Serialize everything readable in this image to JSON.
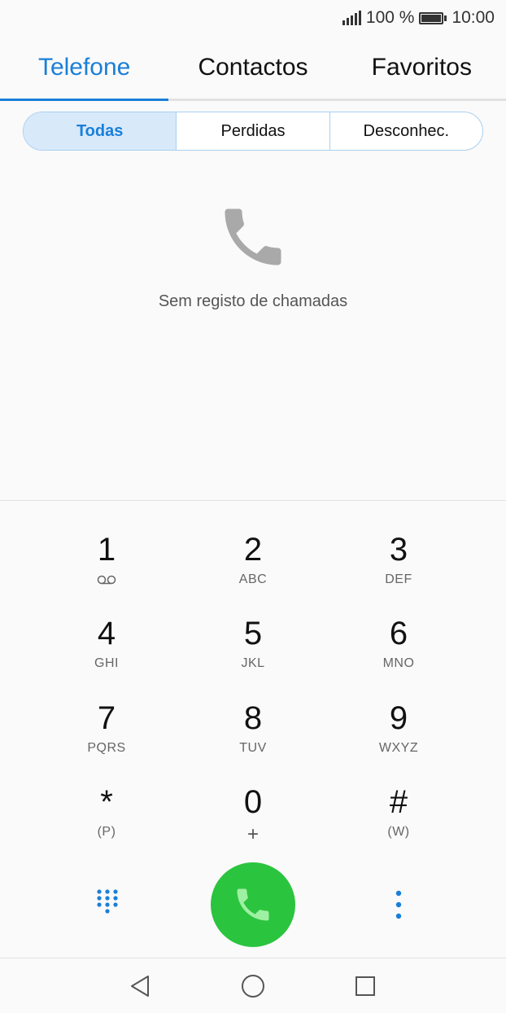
{
  "status_bar": {
    "battery_text": "100 %",
    "time": "10:00",
    "signal_icon": "signal-bars-icon",
    "battery_icon": "battery-full-icon"
  },
  "tabs": [
    {
      "label": "Telefone",
      "active": true
    },
    {
      "label": "Contactos",
      "active": false
    },
    {
      "label": "Favoritos",
      "active": false
    }
  ],
  "filters": [
    {
      "label": "Todas",
      "active": true
    },
    {
      "label": "Perdidas",
      "active": false
    },
    {
      "label": "Desconhec.",
      "active": false
    }
  ],
  "empty_state": {
    "icon": "phone-handset-icon",
    "message": "Sem registo de chamadas"
  },
  "keypad": {
    "keys": [
      {
        "digit": "1",
        "letters": ""
      },
      {
        "digit": "2",
        "letters": "ABC"
      },
      {
        "digit": "3",
        "letters": "DEF"
      },
      {
        "digit": "4",
        "letters": "GHI"
      },
      {
        "digit": "5",
        "letters": "JKL"
      },
      {
        "digit": "6",
        "letters": "MNO"
      },
      {
        "digit": "7",
        "letters": "PQRS"
      },
      {
        "digit": "8",
        "letters": "TUV"
      },
      {
        "digit": "9",
        "letters": "WXYZ"
      },
      {
        "digit": "*",
        "letters": "(P)"
      },
      {
        "digit": "0",
        "letters": "+"
      },
      {
        "digit": "#",
        "letters": "(W)"
      }
    ]
  },
  "actions": {
    "dialpad_icon": "dialpad-grid-icon",
    "call_icon": "call-icon",
    "more_icon": "more-vertical-icon"
  },
  "colors": {
    "accent": "#1a7fd8",
    "call_green": "#2bc43f",
    "segment_active_bg": "#d8e9fa"
  }
}
